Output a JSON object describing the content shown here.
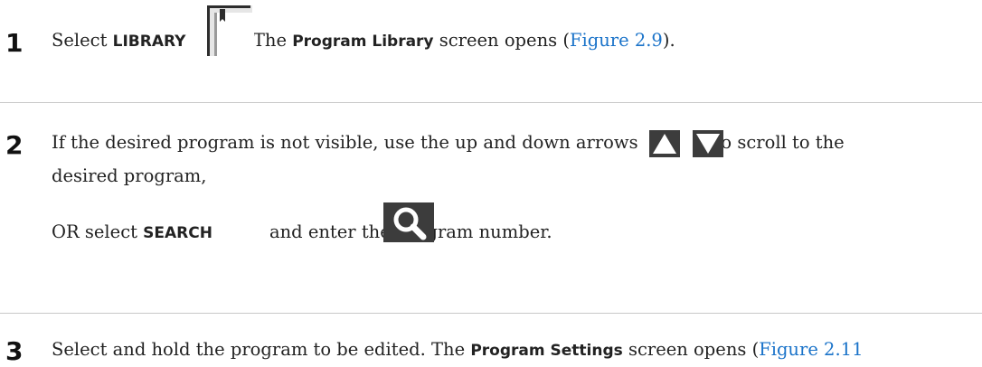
{
  "steps": [
    {
      "number": "1",
      "t1": "Select ",
      "kw1": "LIBRARY",
      "t2": ". The ",
      "kw2": "Program Library",
      "t3": " screen opens (",
      "link": "Figure 2.9",
      "t4": ")."
    },
    {
      "number": "2",
      "line1_a": "If the desired program is not visible, use the up and down arrows",
      "line1_b": "to scroll to the",
      "line2": "desired program,",
      "or_text": "OR select ",
      "kw": "SEARCH",
      "after": "and enter the program number."
    },
    {
      "number": "3",
      "t1": "Select and hold the program to be edited. The ",
      "kw": "Program Settings",
      "t2": " screen opens (",
      "link": "Figure 2.11"
    }
  ],
  "icons": {
    "library": "library-icon",
    "up": "up-arrow-icon",
    "down": "down-arrow-icon",
    "search": "search-icon"
  },
  "colors": {
    "link": "#1a73c9",
    "icon_dark": "#3c3c3c",
    "divider": "#c8c8c8"
  }
}
